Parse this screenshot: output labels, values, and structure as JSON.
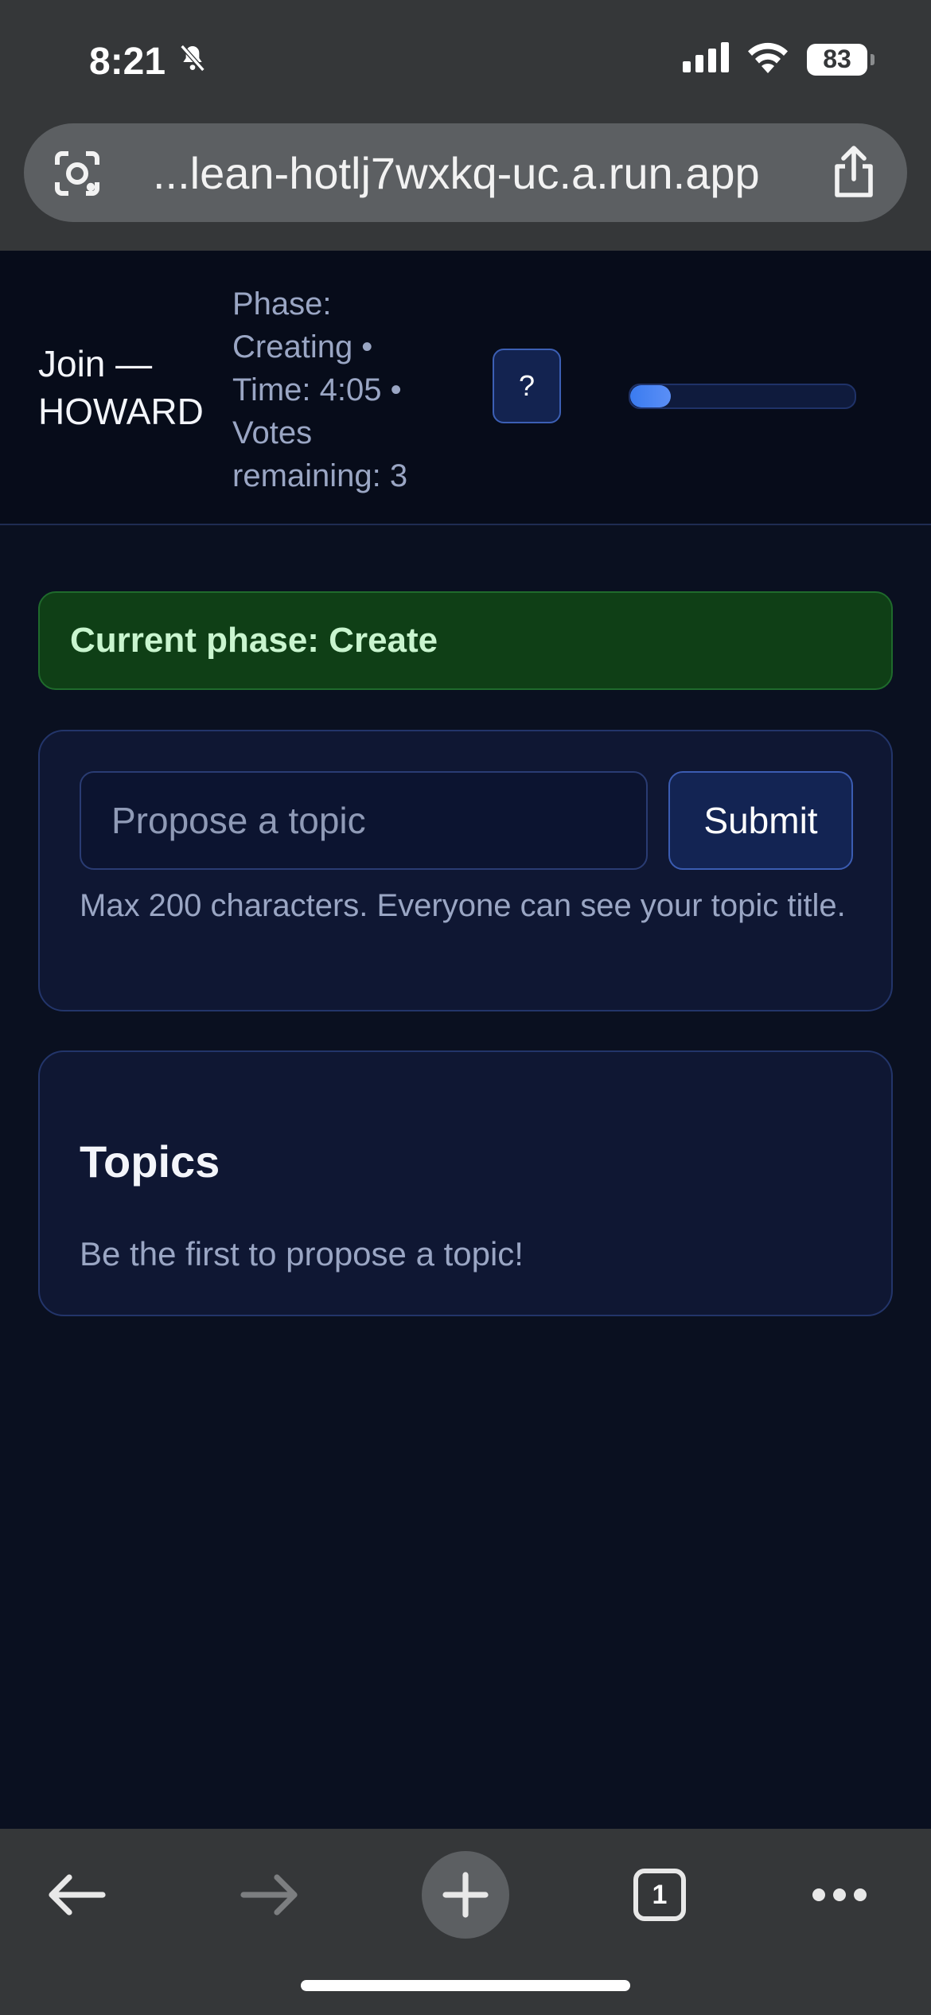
{
  "status_bar": {
    "time": "8:21",
    "battery": "83",
    "icons": [
      "bell-slash-icon",
      "signal-icon",
      "wifi-icon",
      "battery-icon"
    ]
  },
  "browser": {
    "url": "...lean-hotlj7wxkq-uc.a.run.app",
    "icons": {
      "left": "lens-icon",
      "right": "share-icon"
    },
    "toolbar": {
      "tab_count": "1",
      "icons": [
        "back-arrow-icon",
        "forward-arrow-icon",
        "plus-icon",
        "tabs-icon",
        "more-icon"
      ]
    }
  },
  "header": {
    "join_title": "Join — HOWARD",
    "phase_line": "Phase: Creating •",
    "time_line": "Time: 4:05 •",
    "votes_line": "Votes remaining: 3",
    "help_label": "?",
    "progress_fraction": 0.18
  },
  "banner": {
    "text": "Current phase: Create"
  },
  "propose": {
    "placeholder": "Propose a topic",
    "value": "",
    "submit_label": "Submit",
    "hint": "Max 200 characters. Everyone can see your topic title."
  },
  "topics": {
    "title": "Topics",
    "empty_message": "Be the first to propose a topic!"
  },
  "colors": {
    "page_bg": "#0a1020",
    "card_bg": "#0f1733",
    "accent": "#3a7bf0",
    "banner_bg": "#0f3f16",
    "banner_text": "#c9f5cf"
  }
}
